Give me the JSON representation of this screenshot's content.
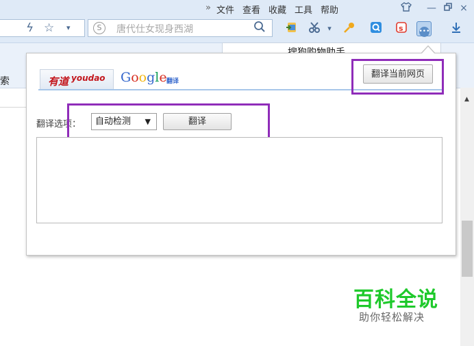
{
  "menubar": {
    "chevron": "»",
    "items": [
      "文件",
      "查看",
      "收藏",
      "工具",
      "帮助"
    ]
  },
  "window_controls": {
    "skin_icon": "shirt-icon",
    "minimize": "—",
    "restore": "restore-icon",
    "close": "×"
  },
  "toolbar": {
    "search_placeholder": "唐代仕女现身西湖",
    "accent_color": "#5b8ec8"
  },
  "tab_behind": "搜狗购物助手",
  "left_page_text": "搜索",
  "popup": {
    "providers": {
      "youdao_zh": "有道",
      "youdao_en": "youdao",
      "google": [
        "G",
        "o",
        "o",
        "g",
        "l",
        "e"
      ],
      "google_sub": "翻译"
    },
    "translate_page_button": "翻译当前网页",
    "option_label": "翻译选项：",
    "language_select": "自动检测",
    "select_arrow": "▼",
    "translate_button": "翻译",
    "textarea_value": ""
  },
  "highlight_color": "#8f2cb9",
  "watermark": {
    "title": "百科全说",
    "subtitle": "助你轻松解决"
  }
}
